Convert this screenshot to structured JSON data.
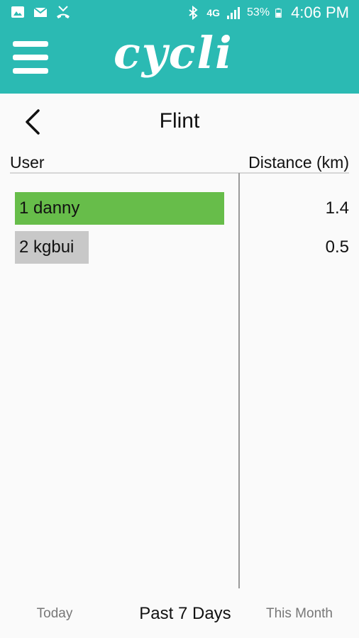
{
  "status_bar": {
    "battery_percent": "53%",
    "time": "4:06 PM",
    "network": "4G",
    "icons_left": [
      "image-icon",
      "mail-icon",
      "missed-call-icon"
    ],
    "icons_right": [
      "bluetooth-icon",
      "network-4g-icon",
      "signal-icon",
      "battery-icon"
    ]
  },
  "app": {
    "logo_text": "cycli",
    "accent_color": "#2bbab3"
  },
  "header": {
    "title": "Flint"
  },
  "table": {
    "columns": [
      "User",
      "Distance (km)"
    ],
    "rows": [
      {
        "label": "1 danny",
        "distance": "1.4",
        "bar_color": "#67bd4a"
      },
      {
        "label": "2 kgbui",
        "distance": "0.5",
        "bar_color": "#c8c8c8"
      }
    ]
  },
  "tabs": [
    {
      "label": "Today",
      "selected": false
    },
    {
      "label": "Past 7 Days",
      "selected": true
    },
    {
      "label": "This Month",
      "selected": false
    }
  ]
}
